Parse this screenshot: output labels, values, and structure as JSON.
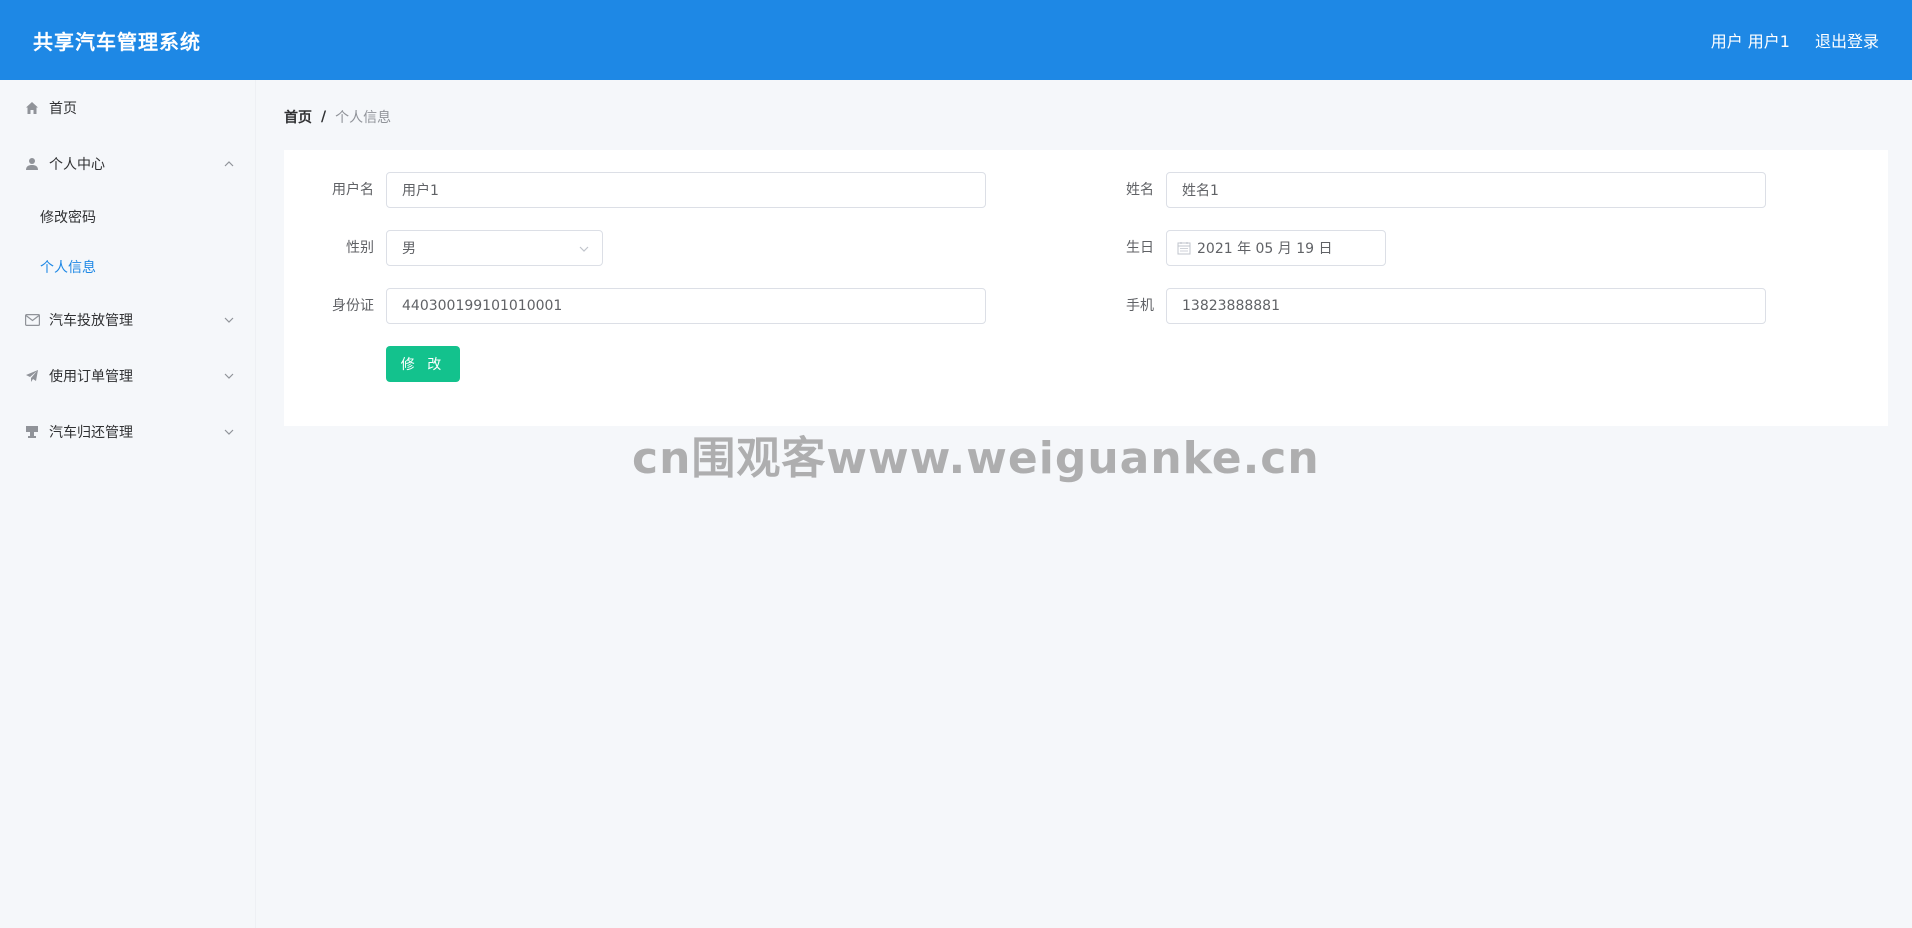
{
  "header": {
    "title": "共享汽车管理系统",
    "user_label": "用户 用户1",
    "logout_label": "退出登录"
  },
  "sidebar": {
    "items": [
      {
        "label": "首页",
        "icon": "home-icon"
      },
      {
        "label": "个人中心",
        "icon": "user-icon",
        "expanded": true,
        "children": [
          {
            "label": "修改密码",
            "active": false
          },
          {
            "label": "个人信息",
            "active": true
          }
        ]
      },
      {
        "label": "汽车投放管理",
        "icon": "mail-icon"
      },
      {
        "label": "使用订单管理",
        "icon": "paper-plane-icon"
      },
      {
        "label": "汽车归还管理",
        "icon": "stamp-icon"
      }
    ]
  },
  "breadcrumb": {
    "home": "首页",
    "separator": "/",
    "current": "个人信息"
  },
  "form": {
    "username_label": "用户名",
    "username_value": "用户1",
    "name_label": "姓名",
    "name_value": "姓名1",
    "gender_label": "性别",
    "gender_value": "男",
    "birthday_label": "生日",
    "birthday_value": "2021 年 05 月 19 日",
    "idcard_label": "身份证",
    "idcard_value": "440300199101010001",
    "phone_label": "手机",
    "phone_value": "13823888881",
    "submit_label": "修 改"
  },
  "watermark": "cn围观客www.weiguanke.cn",
  "colors": {
    "header_bg": "#1e88e5",
    "active_menu": "#1e88e5",
    "submit_bg": "#13c28d"
  }
}
